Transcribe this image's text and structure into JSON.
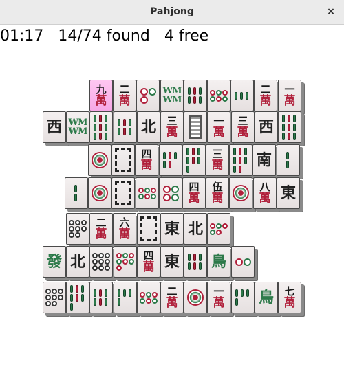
{
  "window": {
    "title": "Pahjong",
    "close_glyph": "×"
  },
  "status": {
    "time": "01:17",
    "found": "14/74 found",
    "free": "4 free"
  },
  "board": {
    "tiles": [
      {
        "id": "r1c1",
        "kind": "wan",
        "num": "九",
        "highlight": true
      },
      {
        "id": "r1c2",
        "kind": "wan",
        "num": "二"
      },
      {
        "id": "r1c3",
        "kind": "dots",
        "count": 3
      },
      {
        "id": "r1c4",
        "kind": "bamboo-wind",
        "num": "WM"
      },
      {
        "id": "r1c5",
        "kind": "bamboo",
        "count": 6
      },
      {
        "id": "r1c6",
        "kind": "dots",
        "count": 6
      },
      {
        "id": "r1c7",
        "kind": "bamboo",
        "count": 3
      },
      {
        "id": "r1c8",
        "kind": "wan",
        "num": "二"
      },
      {
        "id": "r1c9",
        "kind": "wan",
        "num": "一"
      },
      {
        "id": "r2c0",
        "kind": "wind",
        "num": "西"
      },
      {
        "id": "r2c1",
        "kind": "bamboo-wind",
        "num": "WM"
      },
      {
        "id": "r2c2",
        "kind": "bamboo",
        "count": 9
      },
      {
        "id": "r2c3",
        "kind": "bamboo",
        "count": 6
      },
      {
        "id": "r2c4",
        "kind": "wind",
        "num": "北"
      },
      {
        "id": "r2c5",
        "kind": "wan",
        "num": "三"
      },
      {
        "id": "r2c6",
        "kind": "white",
        "num": ""
      },
      {
        "id": "r2c7",
        "kind": "wan",
        "num": "一"
      },
      {
        "id": "r2c8",
        "kind": "wan",
        "num": "三"
      },
      {
        "id": "r2c9",
        "kind": "wind",
        "num": "西"
      },
      {
        "id": "r2c10",
        "kind": "bamboo",
        "count": 9
      },
      {
        "id": "r3c2",
        "kind": "dots",
        "count": 1
      },
      {
        "id": "r3c3",
        "kind": "dragon-white",
        "num": ""
      },
      {
        "id": "r3c4",
        "kind": "wan",
        "num": "四"
      },
      {
        "id": "r3c5",
        "kind": "bamboo",
        "count": 5
      },
      {
        "id": "r3c6",
        "kind": "bamboo",
        "count": 7
      },
      {
        "id": "r3c7",
        "kind": "wan",
        "num": "三"
      },
      {
        "id": "r3c8",
        "kind": "bamboo",
        "count": 8
      },
      {
        "id": "r3c9",
        "kind": "wind",
        "num": "南"
      },
      {
        "id": "r3c10",
        "kind": "bamboo",
        "count": 2
      },
      {
        "id": "r4c1",
        "kind": "bamboo",
        "count": 2
      },
      {
        "id": "r4c2",
        "kind": "dots",
        "count": 1
      },
      {
        "id": "r4c3",
        "kind": "dragon-white",
        "num": ""
      },
      {
        "id": "r4c4",
        "kind": "dots",
        "count": 6
      },
      {
        "id": "r4c5",
        "kind": "dots",
        "count": 4
      },
      {
        "id": "r4c6",
        "kind": "wan",
        "num": "四"
      },
      {
        "id": "r4c7",
        "kind": "wan",
        "num": "伍"
      },
      {
        "id": "r4c8",
        "kind": "dots",
        "count": 1
      },
      {
        "id": "r4c9",
        "kind": "wan",
        "num": "八"
      },
      {
        "id": "r4c10",
        "kind": "wind",
        "num": "東"
      },
      {
        "id": "r5c1",
        "kind": "dots",
        "count": 8
      },
      {
        "id": "r5c2",
        "kind": "wan",
        "num": "二"
      },
      {
        "id": "r5c3",
        "kind": "wan",
        "num": "六"
      },
      {
        "id": "r5c4",
        "kind": "dragon-white",
        "num": ""
      },
      {
        "id": "r5c5",
        "kind": "wind",
        "num": "東"
      },
      {
        "id": "r5c6",
        "kind": "wind",
        "num": "北"
      },
      {
        "id": "r5c7",
        "kind": "dots",
        "count": 5
      },
      {
        "id": "r6c0",
        "kind": "dragon-green",
        "num": "發"
      },
      {
        "id": "r6c1",
        "kind": "wind",
        "num": "北"
      },
      {
        "id": "r6c2",
        "kind": "dots",
        "count": 9
      },
      {
        "id": "r6c3",
        "kind": "dots",
        "count": 7
      },
      {
        "id": "r6c4",
        "kind": "wan",
        "num": "四"
      },
      {
        "id": "r6c5",
        "kind": "wind",
        "num": "東"
      },
      {
        "id": "r6c6",
        "kind": "bamboo",
        "count": 6
      },
      {
        "id": "r6c7",
        "kind": "bird",
        "num": ""
      },
      {
        "id": "r6c8",
        "kind": "dots",
        "count": 2
      },
      {
        "id": "r7c0",
        "kind": "dots",
        "count": 8
      },
      {
        "id": "r7c1",
        "kind": "bamboo",
        "count": 7
      },
      {
        "id": "r7c2",
        "kind": "bamboo",
        "count": 6
      },
      {
        "id": "r7c3",
        "kind": "bamboo",
        "count": 4
      },
      {
        "id": "r7c4",
        "kind": "dots",
        "count": 6
      },
      {
        "id": "r7c5",
        "kind": "wan",
        "num": "二"
      },
      {
        "id": "r7c6",
        "kind": "dots",
        "count": 1
      },
      {
        "id": "r7c7",
        "kind": "wan",
        "num": "一"
      },
      {
        "id": "r7c8",
        "kind": "bamboo",
        "count": 4
      },
      {
        "id": "r7c9",
        "kind": "bird",
        "num": ""
      },
      {
        "id": "r7c10",
        "kind": "wan",
        "num": "七"
      }
    ]
  },
  "colors": {
    "wan_red": "#b0203b",
    "bamboo_green": "#2d7a4a",
    "highlight": "#f6a8e6"
  }
}
